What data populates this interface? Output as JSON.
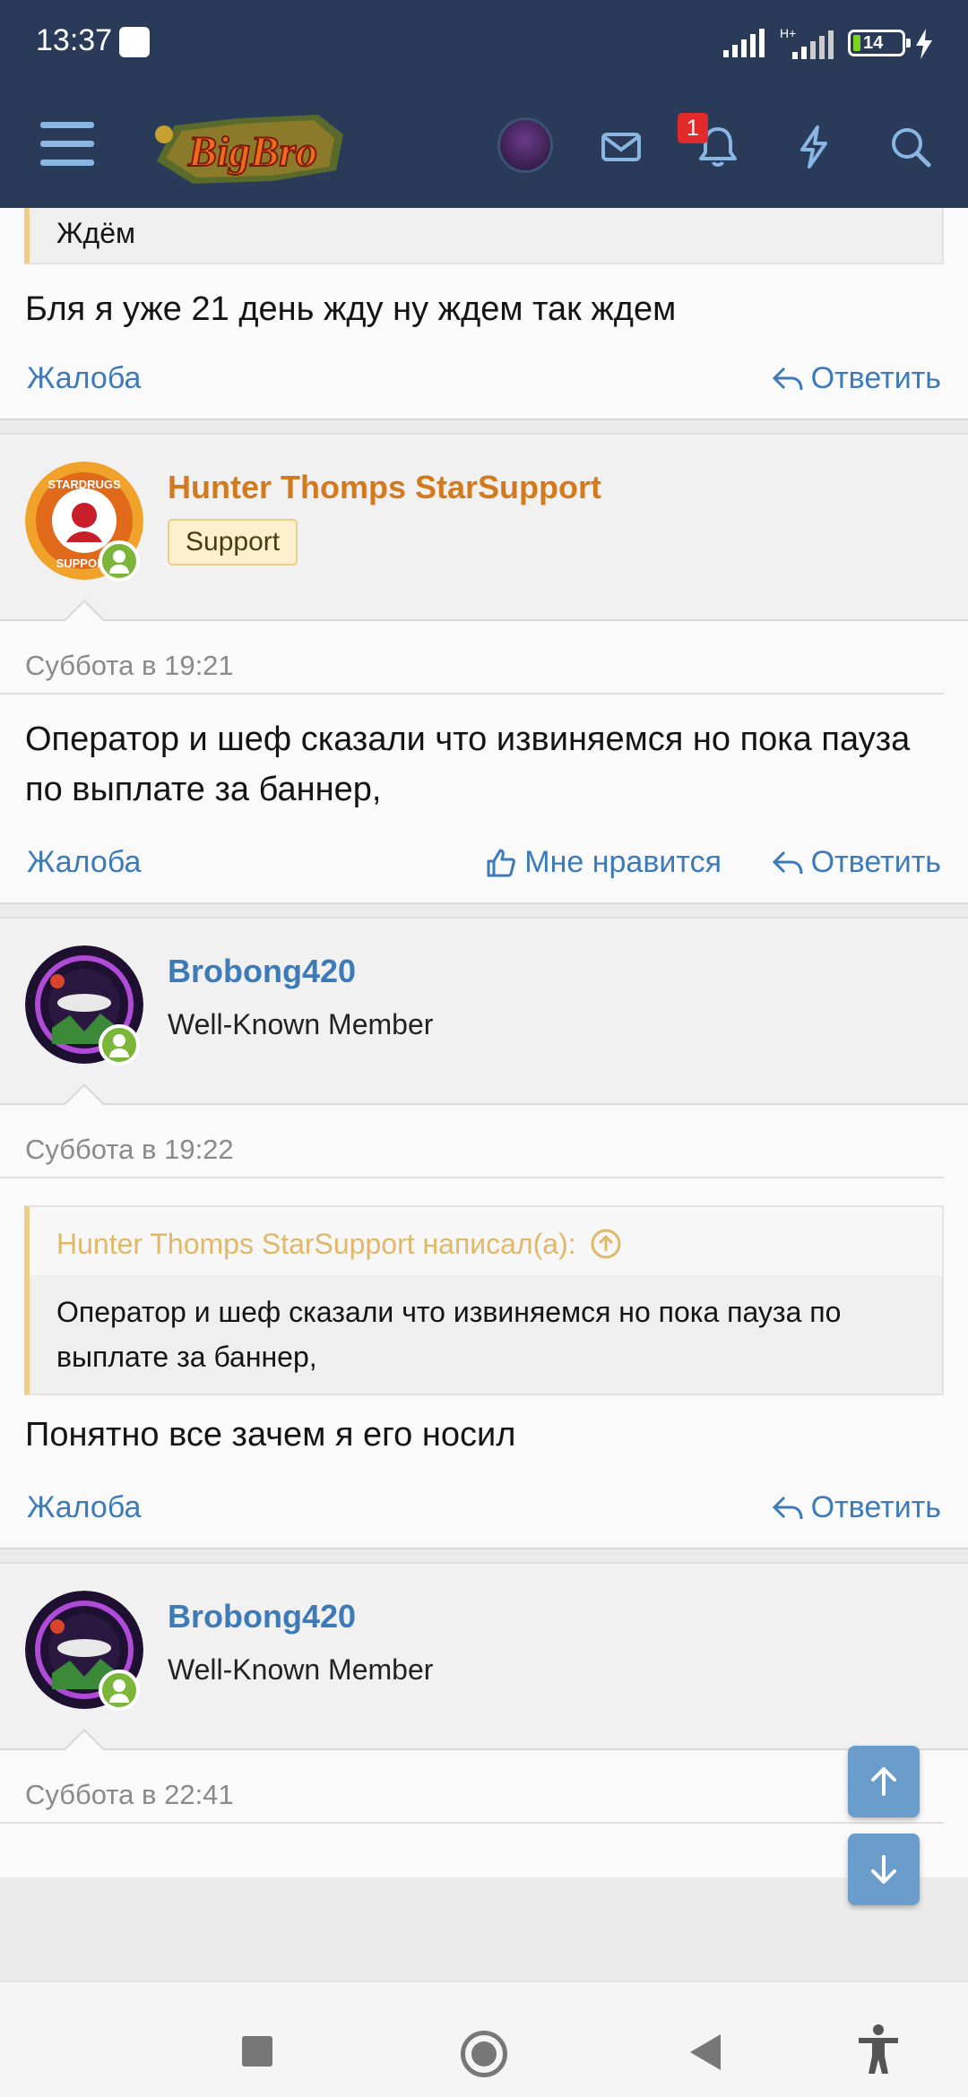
{
  "status_bar": {
    "time": "13:37",
    "battery": "14"
  },
  "header": {
    "logo_text": "BigBro",
    "notification_count": "1",
    "icons": [
      "menu-icon",
      "mail-icon",
      "bell-icon",
      "lightning-icon",
      "search-icon"
    ]
  },
  "posts": [
    {
      "quote_fragment": "Ждём",
      "message": "Бля я уже 21 день жду ну ждем так ждем",
      "report": "Жалоба",
      "reply": "Ответить"
    },
    {
      "username": "Hunter Thomps StarSupport",
      "user_title": "Support",
      "date": "Суббота в 19:21",
      "message": "Оператор и шеф сказали что извиняемся но пока пауза по выплате за баннер,",
      "report": "Жалоба",
      "like": "Мне нравится",
      "reply": "Ответить",
      "avatar_text_top": "STARDRUGS",
      "avatar_text_bottom": "SUPPORT"
    },
    {
      "username": "Brobong420",
      "user_title": "Well-Known Member",
      "date": "Суббота в 19:22",
      "quote_header": "Hunter Thomps StarSupport написал(а):",
      "quote_text": "Оператор и шеф сказали что извиняемся но пока пауза по выплате за баннер,",
      "message": "Понятно все зачем я его носил",
      "report": "Жалоба",
      "reply": "Ответить"
    },
    {
      "username": "Brobong420",
      "user_title": "Well-Known Member",
      "date": "Суббота в 22:41"
    }
  ],
  "colors": {
    "header_bg": "#2a3b5a",
    "link": "#3d7ab8",
    "support_name": "#d47a1e",
    "member_name": "#3d7ab8",
    "online": "#7bb63b",
    "quote_accent": "#eccf85"
  }
}
